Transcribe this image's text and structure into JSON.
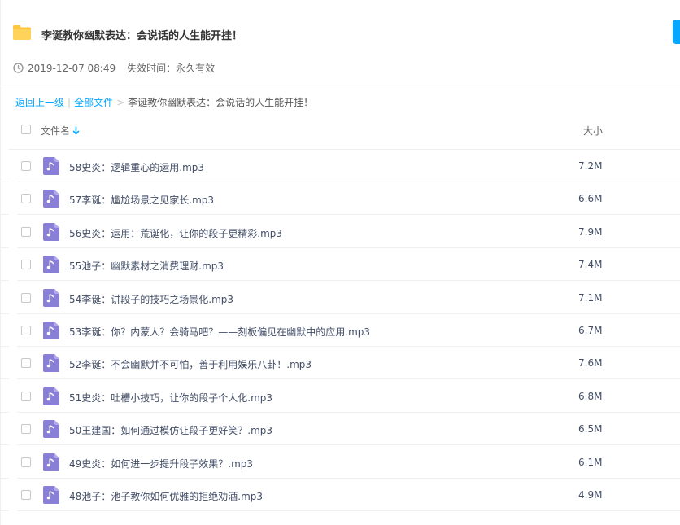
{
  "header": {
    "title": "李诞教你幽默表达：会说话的人生能开挂！",
    "shared_time": "2019-12-07 08:49",
    "expire_label": "失效时间：永久有效",
    "folder_icon": "folder-icon",
    "clock_icon": "clock-icon"
  },
  "breadcrumb": {
    "back": "返回上一级",
    "all_files": "全部文件",
    "current": "李诞教你幽默表达：会说话的人生能开挂！"
  },
  "columns": {
    "name": "文件名",
    "size": "大小"
  },
  "colors": {
    "accent": "#06a7ff",
    "folder": "#ffc53d",
    "audio_icon": "#8a7fd6"
  },
  "files": [
    {
      "name": "58史炎：逻辑重心的运用.mp3",
      "size": "7.2M"
    },
    {
      "name": "57李诞：尴尬场景之见家长.mp3",
      "size": "6.6M"
    },
    {
      "name": "56史炎：运用：荒诞化，让你的段子更精彩.mp3",
      "size": "7.9M"
    },
    {
      "name": "55池子：幽默素材之消费理财.mp3",
      "size": "7.4M"
    },
    {
      "name": "54李诞：讲段子的技巧之场景化.mp3",
      "size": "7.1M"
    },
    {
      "name": "53李诞：你？内蒙人？会骑马吧？——刻板偏见在幽默中的应用.mp3",
      "size": "6.7M"
    },
    {
      "name": "52李诞：不会幽默并不可怕，善于利用娱乐八卦！.mp3",
      "size": "7.6M"
    },
    {
      "name": "51史炎：吐槽小技巧，让你的段子个人化.mp3",
      "size": "6.8M"
    },
    {
      "name": "50王建国：如何通过模仿让段子更好笑？.mp3",
      "size": "6.5M"
    },
    {
      "name": "49史炎：如何进一步提升段子效果？.mp3",
      "size": "6.1M"
    },
    {
      "name": "48池子：池子教你如何优雅的拒绝劝酒.mp3",
      "size": "4.9M"
    }
  ]
}
